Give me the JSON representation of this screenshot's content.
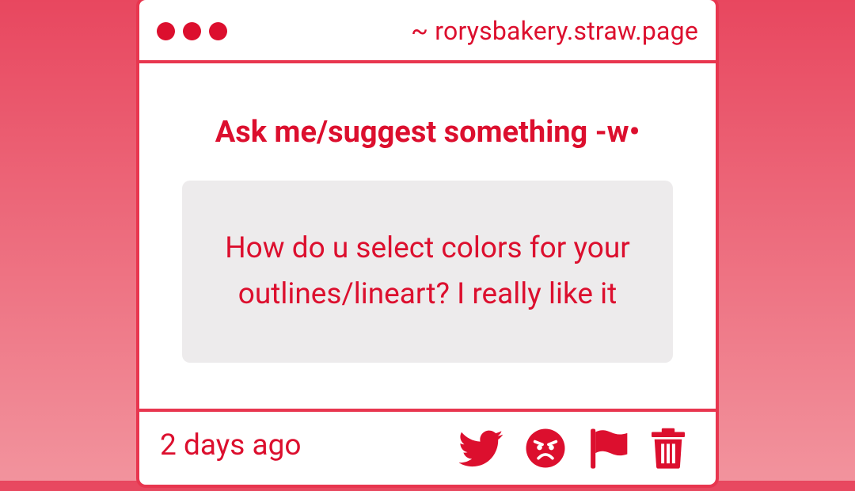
{
  "browser": {
    "window_dots": [
      "close",
      "minimize",
      "maximize"
    ],
    "url": "~ rorysbakery.straw.page"
  },
  "prompt": {
    "title": "Ask me/suggest something -w•"
  },
  "question": {
    "text": "How do u select colors for your outlines/lineart? I really like it"
  },
  "footer": {
    "timestamp": "2 days ago",
    "actions": [
      {
        "name": "share-twitter",
        "icon": "twitter-icon"
      },
      {
        "name": "react-angry",
        "icon": "angry-face-icon"
      },
      {
        "name": "report",
        "icon": "flag-icon"
      },
      {
        "name": "delete",
        "icon": "trash-icon"
      }
    ]
  },
  "colors": {
    "accent": "#dc0f2e",
    "border": "#e8364f",
    "box_background": "#edebec",
    "background_top": "#e8475f",
    "background_bottom": "#f2939d"
  }
}
